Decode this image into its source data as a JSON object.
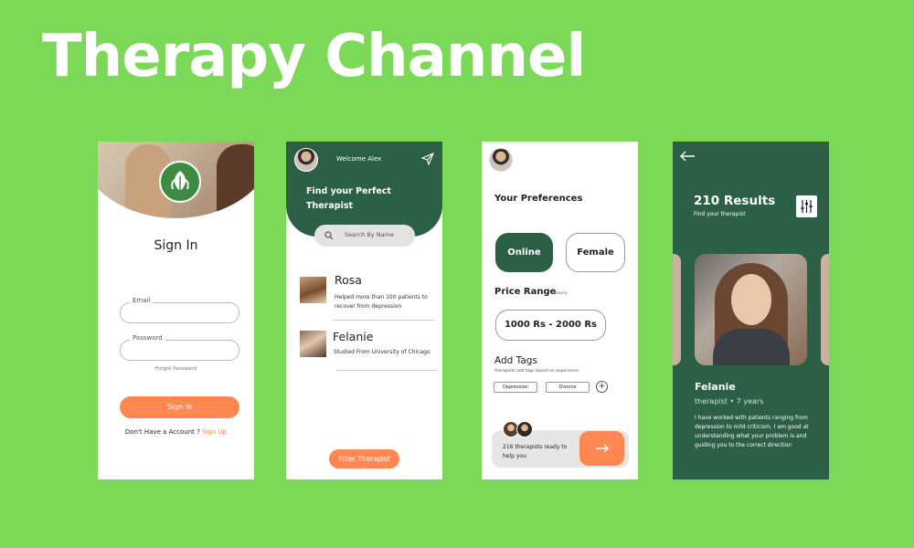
{
  "page": {
    "title": "Therapy Channel",
    "background_color": "#7cd957",
    "accent_green": "#2b5f46",
    "accent_orange": "#ff8752"
  },
  "screen_signin": {
    "title": "Sign In",
    "email_label": "Email",
    "password_label": "Password",
    "forgot_password": "Forgot Password",
    "signin_button": "Sign In",
    "no_account_text": "Don't Have a Account ?",
    "signup_link": "Sign Up",
    "logo_icon": "leaf-icon"
  },
  "screen_find": {
    "welcome": "Welcome Alex",
    "heading": "Find your Perfect Therapist",
    "search_placeholder": "Search By Name",
    "therapists": [
      {
        "name": "Rosa",
        "description": "Helped more than 100 patients to recover from depression"
      },
      {
        "name": "Felanie",
        "description": "Studied From University of Chicago"
      }
    ],
    "filter_button": "Filter Therapist"
  },
  "screen_preferences": {
    "heading": "Your Preferences",
    "mode_option": "Online",
    "gender_option": "Female",
    "price_label": "Price Range",
    "price_unit": "Hourly",
    "price_value": "1000 Rs - 2000 Rs",
    "tags_label": "Add Tags",
    "tags_sub": "therapists add tags based on experience",
    "tags": [
      "Depression",
      "Divorce"
    ],
    "add_tag_symbol": "+",
    "ready_text": "216 therapists ready to help you"
  },
  "screen_results": {
    "results_title": "210 Results",
    "results_sub": "Find your therapist",
    "name": "Felanie",
    "meta": "therapist • 7 years",
    "bio": "I have worked with patients ranging from depression to mild criticism. I am good at understanding what your problem is and guiding you to the correct direction"
  }
}
